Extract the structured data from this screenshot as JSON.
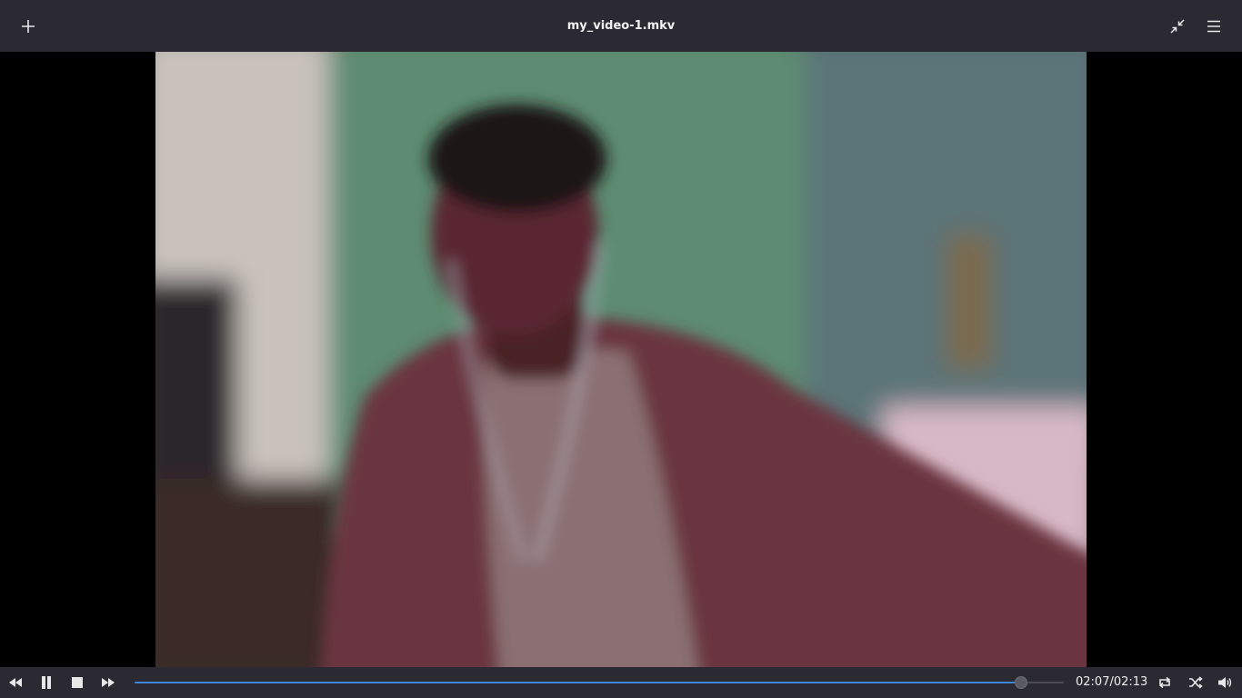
{
  "window": {
    "title": "my_video-1.mkv",
    "add_icon": "plus-icon",
    "unfullscreen_icon": "shrink-arrows-icon",
    "menu_icon": "hamburger-menu-icon"
  },
  "video": {
    "description_icon": "video-frame"
  },
  "controls": {
    "rewind_icon": "rewind-icon",
    "pause_icon": "pause-icon",
    "stop_icon": "stop-icon",
    "forward_icon": "fast-forward-icon",
    "progress": 0.954,
    "elapsed": "02:07",
    "separator": "/",
    "duration": "02:13",
    "repeat_icon": "repeat-icon",
    "shuffle_icon": "shuffle-icon",
    "volume_icon": "speaker-icon"
  },
  "colors": {
    "bar_bg": "#2b2a33",
    "accent": "#3d86d6",
    "video_bg": "#000000"
  }
}
